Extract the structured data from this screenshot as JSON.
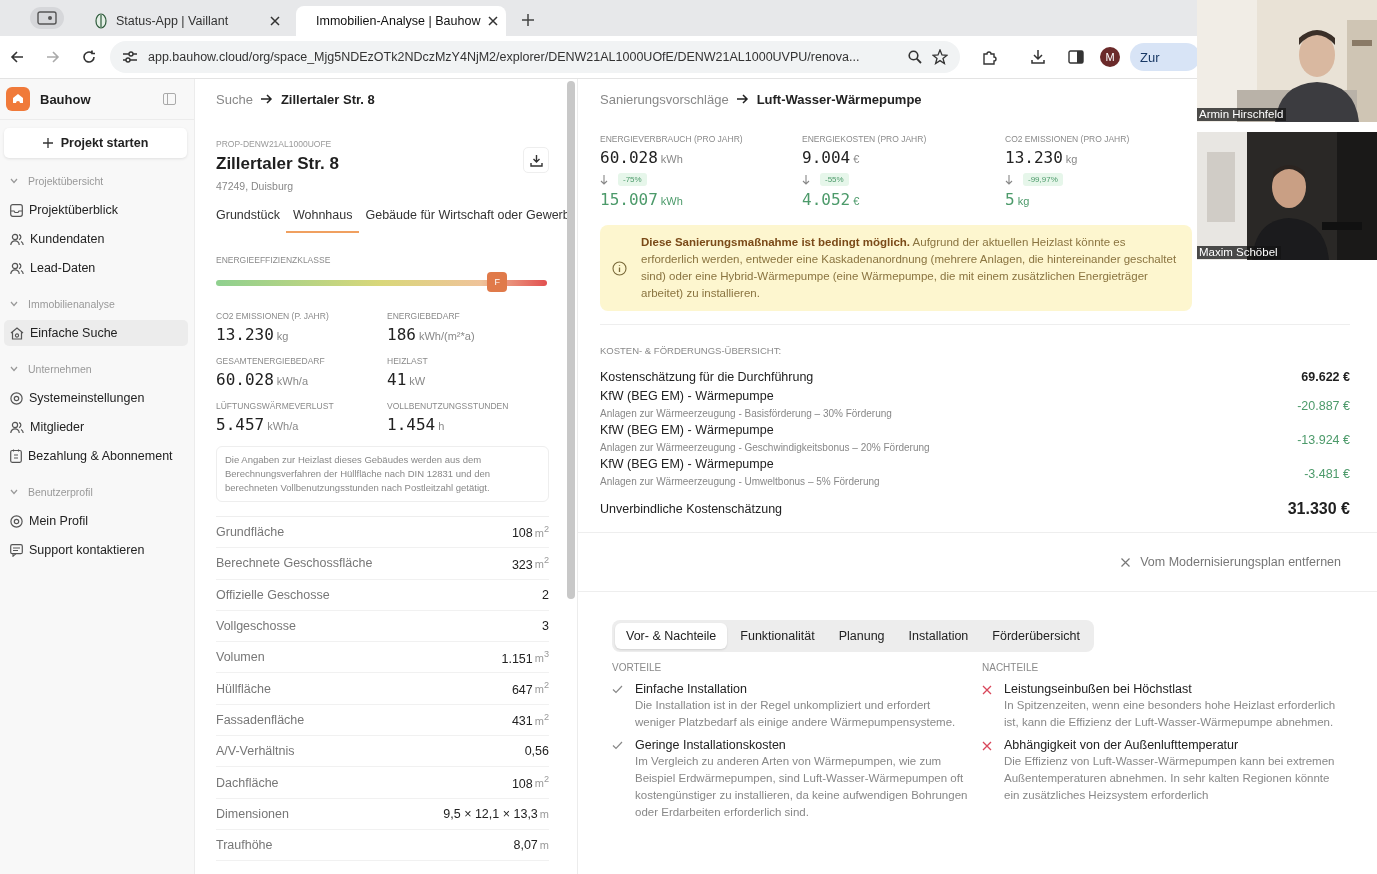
{
  "browser": {
    "tabs": [
      {
        "title": "Status-App | Vaillant",
        "selected": false
      },
      {
        "title": "Immobilien-Analyse | Bauhow",
        "selected": true
      }
    ],
    "url": "app.bauhow.cloud/org/space_Mjg5NDEzOTk2NDczMzY4NjM2/explorer/DENW21AL1000UOfE/DENW21AL1000UVPU/renova...",
    "profile": "M",
    "side_button": "Zur"
  },
  "video_call": {
    "participants": [
      {
        "name": "Armin Hirschfeld"
      },
      {
        "name": "Maxim Schöbel"
      }
    ]
  },
  "sidebar": {
    "brand": "Bauhow",
    "new_project": "Projekt starten",
    "sections": [
      {
        "title": "Projektübersicht",
        "expanded": true,
        "items": [
          {
            "label": "Projektüberblick",
            "selected": false
          },
          {
            "label": "Kundendaten",
            "selected": false
          },
          {
            "label": "Lead-Daten",
            "selected": false
          }
        ]
      },
      {
        "title": "Immobilienanalyse",
        "expanded": true,
        "items": [
          {
            "label": "Einfache Suche",
            "selected": true
          }
        ]
      },
      {
        "title": "Unternehmen",
        "expanded": true,
        "items": [
          {
            "label": "Systemeinstellungen",
            "selected": false
          },
          {
            "label": "Mitglieder",
            "selected": false
          },
          {
            "label": "Bezahlung & Abonnement",
            "selected": false
          }
        ]
      },
      {
        "title": "Benutzerprofil",
        "expanded": true,
        "items": [
          {
            "label": "Mein Profil",
            "selected": false
          },
          {
            "label": "Support kontaktieren",
            "selected": false
          }
        ]
      }
    ]
  },
  "property": {
    "breadcrumb": [
      "Suche",
      "Zillertaler Str. 8"
    ],
    "id": "PROP-DENW21AL1000UOFE",
    "title": "Zillertaler Str. 8",
    "address": "47249, Duisburg",
    "tabs": [
      {
        "label": "Grundstück",
        "selected": false
      },
      {
        "label": "Wohnhaus",
        "selected": true
      },
      {
        "label": "Gebäude für Wirtschaft oder Gewerb",
        "selected": false
      }
    ],
    "energy_class": {
      "label": "ENERGIEEFFIZIENZKLASSE",
      "grade": "F",
      "level": 0.85
    },
    "metrics": [
      {
        "label": "CO2 EMISSIONEN (P. JAHR)",
        "value": "13.230",
        "unit": "kg"
      },
      {
        "label": "ENERGIEBEDARF",
        "value": "186",
        "unit": "kWh/(m²*a)"
      },
      {
        "label": "GESAMTENERGIEBEDARF",
        "value": "60.028",
        "unit": "kWh/a"
      },
      {
        "label": "HEIZLAST",
        "value": "41",
        "unit": "kW"
      },
      {
        "label": "LÜFTUNGSWÄRMEVERLUST",
        "value": "5.457",
        "unit": "kWh/a"
      },
      {
        "label": "VOLLBENUTZUNGSSTUNDEN",
        "value": "1.454",
        "unit": "h"
      }
    ],
    "note": "Die Angaben zur Heizlast dieses Gebäudes werden aus dem Berechnungsverfahren der Hüllfläche nach DIN 12831 und den berechneten Vollbenutzungsstunden nach Postleitzahl getätigt.",
    "facts": [
      {
        "label": "Grundfläche",
        "value": "108",
        "unit": "m$^{2}$"
      },
      {
        "label": "Berechnete Geschossfläche",
        "value": "323",
        "unit": "m$^{2}$"
      },
      {
        "label": "Offizielle Geschosse",
        "value": "2"
      },
      {
        "label": "Vollgeschosse",
        "value": "3"
      },
      {
        "label": "Volumen",
        "value": "1.151",
        "unit": "m$^{3}$"
      },
      {
        "label": "Hüllfläche",
        "value": "647",
        "unit": "m$^{2}$"
      },
      {
        "label": "Fassadenfläche",
        "value": "431",
        "unit": "m$^{2}$"
      },
      {
        "label": "A/V-Verhältnis",
        "value": "0,56"
      },
      {
        "label": "Dachfläche",
        "value": "108",
        "unit": "m$^{2}$"
      },
      {
        "label": "Dimensionen",
        "value": "9,5 × 12,1 × 13,3",
        "unit": "m"
      },
      {
        "label": "Traufhöhe",
        "value": "8,07",
        "unit": "m"
      }
    ]
  },
  "measure": {
    "breadcrumb": [
      "Sanierungsvorschläge",
      "Luft-Wasser-Wärmepumpe"
    ],
    "stats": [
      {
        "label": "ENERGIEVERBRAUCH (PRO JAHR)",
        "value": "60.028",
        "unit": "kWh",
        "change": "-75%",
        "new_value": "15.007",
        "new_unit": "kWh"
      },
      {
        "label": "ENERGIEKOSTEN (PRO JAHR)",
        "value": "9.004",
        "unit": "€",
        "change": "-55%",
        "new_value": "4.052",
        "new_unit": "€"
      },
      {
        "label": "CO2 EMISSIONEN (PRO JAHR)",
        "value": "13.230",
        "unit": "kg",
        "change": "-99,97%",
        "new_value": "5",
        "new_unit": "kg"
      }
    ],
    "warning": "**Diese Sanierungsmaßnahme ist bedingt möglich.** Aufgrund der aktuellen Heizlast könnte es erforderlich werden, entweder eine Kaskadenanordnung (mehrere Anlagen, die hintereinander geschaltet sind) oder eine Hybrid-Wärmepumpe (eine Wärmepumpe, die mit einem zusätzlichen Energieträger arbeitet) zu installieren.",
    "costs": {
      "title": "KOSTEN- & FÖRDERUNGS-ÜBERSICHT:",
      "rows": [
        {
          "kind": "cost",
          "label": "Kostenschätzung für die Durchführung",
          "amount": "69.622 €"
        },
        {
          "kind": "subsidy",
          "label": "KfW (BEG EM) - Wärmepumpe",
          "sublabel": "Anlagen zur Wärmeerzeugung - Basisförderung – 30% Förderung",
          "amount": "-20.887 €"
        },
        {
          "kind": "subsidy",
          "label": "KfW (BEG EM) - Wärmepumpe",
          "sublabel": "Anlagen zur Wärmeerzeugung - Geschwindigkeitsbonus – 20% Förderung",
          "amount": "-13.924 €"
        },
        {
          "kind": "subsidy",
          "label": "KfW (BEG EM) - Wärmepumpe",
          "sublabel": "Anlagen zur Wärmeerzeugung - Umweltbonus – 5% Förderung",
          "amount": "-3.481 €"
        }
      ],
      "total": {
        "label": "Unverbindliche Kostenschätzung",
        "amount": "31.330 €"
      }
    },
    "remove_action": "Vom Modernisierungsplan entfernen",
    "tabs": [
      {
        "label": "Vor- & Nachteile",
        "selected": true
      },
      {
        "label": "Funktionalität",
        "selected": false
      },
      {
        "label": "Planung",
        "selected": false
      },
      {
        "label": "Installation",
        "selected": false
      },
      {
        "label": "Förderübersicht",
        "selected": false
      }
    ],
    "columns": [
      {
        "kind": "pro",
        "title": "VORTEILE",
        "items": [
          {
            "title": "Einfache Installation",
            "text": "Die Installation ist in der Regel unkompliziert und erfordert weniger Platzbedarf als einige andere Wärmepumpensysteme."
          },
          {
            "title": "Geringe Installationskosten",
            "text": "Im Vergleich zu anderen Arten von Wärmepumpen, wie zum Beispiel Erdwärmepumpen, sind Luft-Wasser-Wärmepumpen oft kostengünstiger zu installieren, da keine aufwendigen Bohrungen oder Erdarbeiten erforderlich sind."
          }
        ]
      },
      {
        "kind": "con",
        "title": "NACHTEILE",
        "items": [
          {
            "title": "Leistungseinbußen bei Höchstlast",
            "text": "In Spitzenzeiten, wenn eine besonders hohe Heizlast erforderlich ist, kann die Effizienz der Luft-Wasser-Wärmepumpe abnehmen."
          },
          {
            "title": "Abhängigkeit von der Außenlufttemperatur",
            "text": "Die Effizienz von Luft-Wasser-Wärmepumpen kann bei extremen Außentemperaturen abnehmen. In sehr kalten Regionen könnte ein zusätzliches Heizsystem erforderlich"
          }
        ]
      }
    ]
  }
}
